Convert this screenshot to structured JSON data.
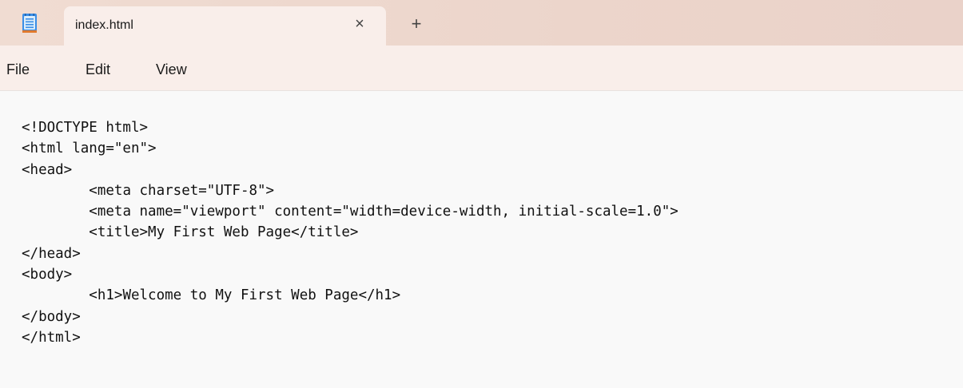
{
  "tab": {
    "title": "index.html",
    "close_glyph": "×",
    "new_tab_glyph": "+"
  },
  "app_icon": "notepad-icon",
  "menu": {
    "file": "File",
    "edit": "Edit",
    "view": "View"
  },
  "editor": {
    "lines": [
      "<!DOCTYPE html>",
      "<html lang=\"en\">",
      "<head>",
      "\t<meta charset=\"UTF-8\">",
      "\t<meta name=\"viewport\" content=\"width=device-width, initial-scale=1.0\">",
      "\t<title>My First Web Page</title>",
      "</head>",
      "<body>",
      "\t<h1>Welcome to My First Web Page</h1>",
      "</body>",
      "</html>"
    ]
  },
  "colors": {
    "titlebar": "#ecd5cb",
    "tab_and_menu": "#f9eeea",
    "editor_bg": "#f9f9f9",
    "icon_blue": "#3a8ee6",
    "icon_orange": "#e07a2e"
  }
}
